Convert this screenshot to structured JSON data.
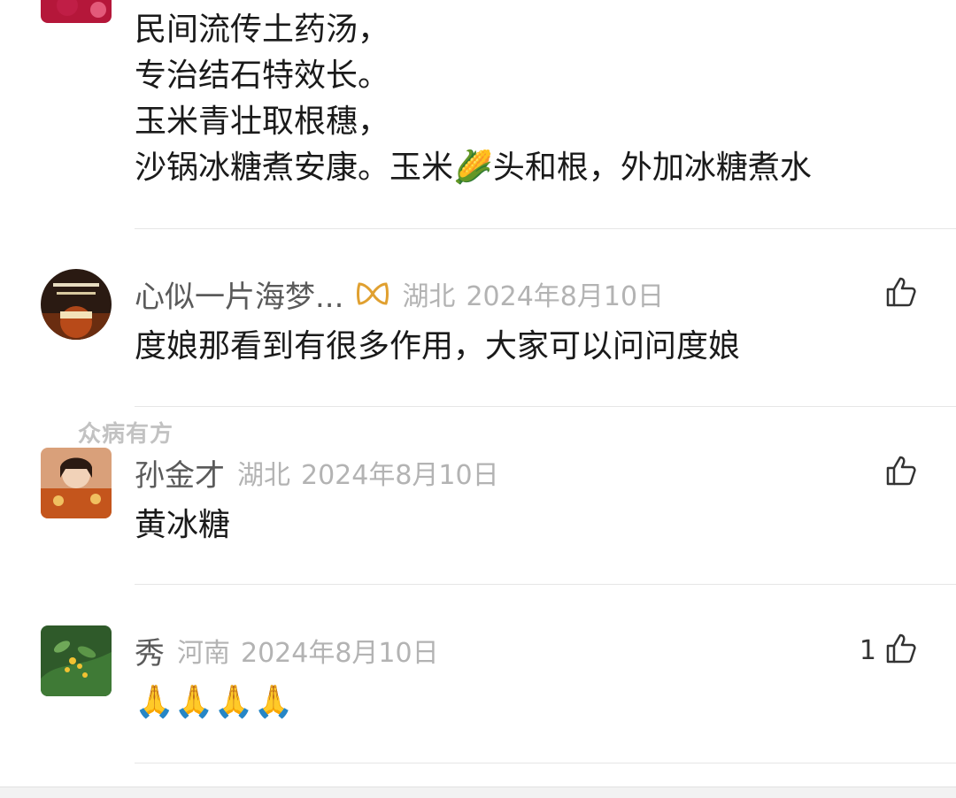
{
  "comments": [
    {
      "body_lines": [
        "民间流传土药汤，",
        "专治结石特效长。",
        "玉米青壮取根穗，",
        "沙锅冰糖煮安康。玉米🌽头和根，外加冰糖煮水"
      ]
    },
    {
      "username": "心似一片海梦...",
      "location": "湖北",
      "date": "2024年8月10日",
      "body": "度娘那看到有很多作用，大家可以问问度娘",
      "likes": ""
    },
    {
      "username": "孙金才",
      "location": "湖北",
      "date": "2024年8月10日",
      "body": "黄冰糖",
      "likes": ""
    },
    {
      "username": "秀",
      "location": "河南",
      "date": "2024年8月10日",
      "body": "🙏🙏🙏🙏",
      "likes": "1"
    }
  ],
  "watermark": "众病有方",
  "icons": {
    "like": "thumbs-up-icon",
    "badge": "gold-ribbon-badge-icon"
  },
  "colors": {
    "username": "#5a5a5a",
    "meta": "#b3b3b3",
    "body": "#1a1a1a",
    "badge": "#e0a030"
  }
}
